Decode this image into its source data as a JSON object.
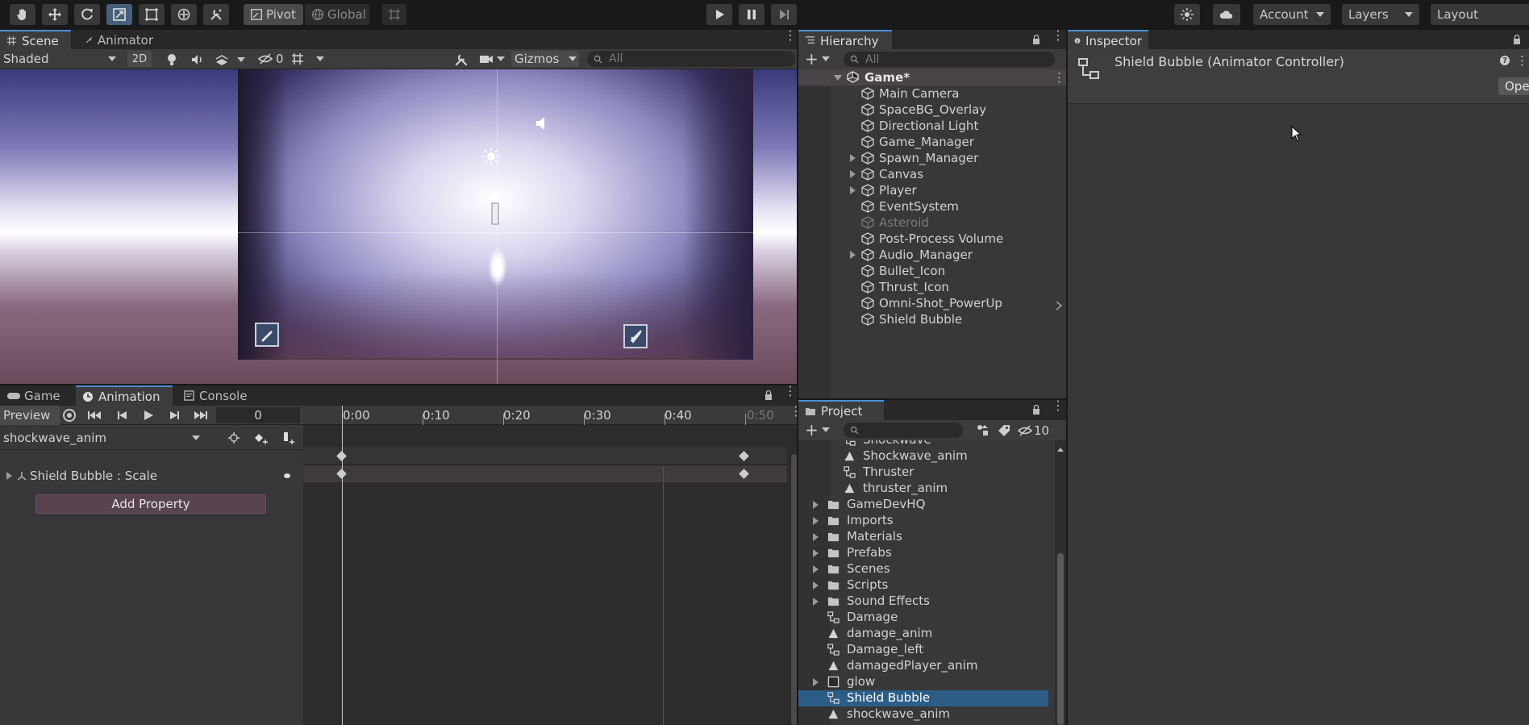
{
  "toolbar": {
    "pivot": "Pivot",
    "global": "Global",
    "account": "Account",
    "layers": "Layers",
    "layout": "Layout"
  },
  "scene": {
    "tabs": [
      "Scene",
      "Animator"
    ],
    "shading": "Shaded",
    "mode_2d": "2D",
    "hidden_count": "0",
    "gizmos": "Gizmos",
    "search_placeholder": "All"
  },
  "hierarchy": {
    "tab": "Hierarchy",
    "search_placeholder": "All",
    "scene_name": "Game*",
    "items": [
      {
        "label": "Main Camera",
        "expandable": false,
        "disabled": false
      },
      {
        "label": "SpaceBG_Overlay",
        "expandable": false,
        "disabled": false
      },
      {
        "label": "Directional Light",
        "expandable": false,
        "disabled": false
      },
      {
        "label": "Game_Manager",
        "expandable": false,
        "disabled": false
      },
      {
        "label": "Spawn_Manager",
        "expandable": true,
        "disabled": false
      },
      {
        "label": "Canvas",
        "expandable": true,
        "disabled": false
      },
      {
        "label": "Player",
        "expandable": true,
        "disabled": false
      },
      {
        "label": "EventSystem",
        "expandable": false,
        "disabled": false
      },
      {
        "label": "Asteroid",
        "expandable": false,
        "disabled": true
      },
      {
        "label": "Post-Process Volume",
        "expandable": false,
        "disabled": false
      },
      {
        "label": "Audio_Manager",
        "expandable": true,
        "disabled": false
      },
      {
        "label": "Bullet_Icon",
        "expandable": false,
        "disabled": false
      },
      {
        "label": "Thrust_Icon",
        "expandable": false,
        "disabled": false
      },
      {
        "label": "Omni-Shot_PowerUp",
        "expandable": false,
        "disabled": false
      },
      {
        "label": "Shield Bubble",
        "expandable": false,
        "disabled": false
      }
    ]
  },
  "inspector": {
    "tab": "Inspector",
    "title": "Shield Bubble (Animator Controller)",
    "open_button": "Ope"
  },
  "animation": {
    "tabs": [
      "Game",
      "Animation",
      "Console"
    ],
    "preview": "Preview",
    "frame": "0",
    "clip": "shockwave_anim",
    "property": "Shield Bubble : Scale",
    "add_property": "Add Property",
    "ticks": [
      "0:00",
      "0:10",
      "0:20",
      "0:30",
      "0:40",
      "0:50"
    ]
  },
  "project": {
    "tab": "Project",
    "hidden_count": "10",
    "items": [
      {
        "label": "Shockwave",
        "kind": "controller",
        "indent": 1,
        "expandable": false,
        "selected": false
      },
      {
        "label": "Shockwave_anim",
        "kind": "anim",
        "indent": 1,
        "expandable": false,
        "selected": false
      },
      {
        "label": "Thruster",
        "kind": "controller",
        "indent": 1,
        "expandable": false,
        "selected": false
      },
      {
        "label": "thruster_anim",
        "kind": "anim",
        "indent": 1,
        "expandable": false,
        "selected": false
      },
      {
        "label": "GameDevHQ",
        "kind": "folder",
        "indent": 0,
        "expandable": true,
        "selected": false
      },
      {
        "label": "Imports",
        "kind": "folder",
        "indent": 0,
        "expandable": true,
        "selected": false
      },
      {
        "label": "Materials",
        "kind": "folder",
        "indent": 0,
        "expandable": true,
        "selected": false
      },
      {
        "label": "Prefabs",
        "kind": "folder",
        "indent": 0,
        "expandable": true,
        "selected": false
      },
      {
        "label": "Scenes",
        "kind": "folder",
        "indent": 0,
        "expandable": true,
        "selected": false
      },
      {
        "label": "Scripts",
        "kind": "folder",
        "indent": 0,
        "expandable": true,
        "selected": false
      },
      {
        "label": "Sound Effects",
        "kind": "folder",
        "indent": 0,
        "expandable": true,
        "selected": false
      },
      {
        "label": "Damage",
        "kind": "controller",
        "indent": 0,
        "expandable": false,
        "selected": false
      },
      {
        "label": "damage_anim",
        "kind": "anim",
        "indent": 0,
        "expandable": false,
        "selected": false
      },
      {
        "label": "Damage_left",
        "kind": "controller",
        "indent": 0,
        "expandable": false,
        "selected": false
      },
      {
        "label": "damagedPlayer_anim",
        "kind": "anim",
        "indent": 0,
        "expandable": false,
        "selected": false
      },
      {
        "label": "glow",
        "kind": "material",
        "indent": 0,
        "expandable": true,
        "selected": false
      },
      {
        "label": "Shield Bubble",
        "kind": "controller",
        "indent": 0,
        "expandable": false,
        "selected": true
      },
      {
        "label": "shockwave_anim",
        "kind": "anim",
        "indent": 0,
        "expandable": false,
        "selected": false
      }
    ]
  },
  "colors": {
    "accent": "#4a8fd8",
    "selection": "#2c5d87",
    "panel": "#383838",
    "add_property_button": "#584450"
  }
}
